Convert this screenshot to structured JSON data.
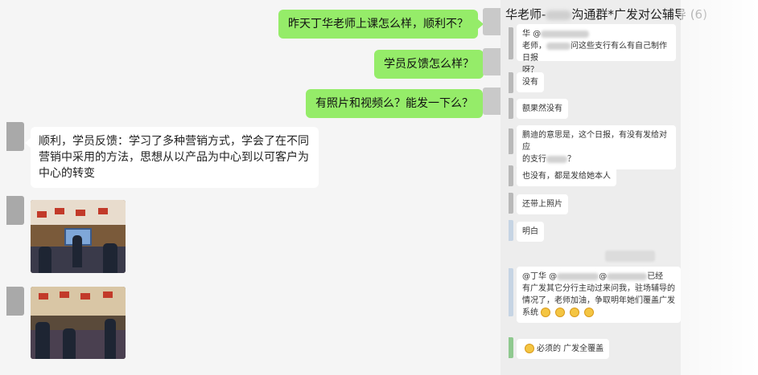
{
  "chat_left": {
    "outgoing": [
      "昨天丁华老师上课怎么样，顺利不？",
      "学员反馈怎么样？",
      "有照片和视频么？能发一下么？"
    ],
    "incoming_text": "顺利，学员反馈：学习了多种营销方式，学会了在不同营销中采用的方法，思想从以产品为中心到以可客户为中心的转变"
  },
  "chat_right": {
    "title_prefix": "华老师-",
    "title_suffix": "沟通群*广发对公辅导 (6)",
    "msg1": {
      "line1": "华 @",
      "line2_a": "老师，",
      "line2_b": "问这些支行有么有自己制作日报",
      "line3": "呀？"
    },
    "msg2": "没有",
    "msg3": "额果然没有",
    "msg4": {
      "line1": "鹏迪的意思是，这个日报，有没有发给对应",
      "line2_a": "的支行",
      "line2_b": "？"
    },
    "msg5": "也没有，都是发给她本人",
    "msg6": "还带上照片",
    "msg7": "明白",
    "msg8": {
      "line1_a": "@丁华 @",
      "line1_b": "@",
      "line1_c": "已经",
      "line2": "有广发其它分行主动过来问我，驻场辅导的",
      "line3": "情况了，老师加油，争取明年她们覆盖广发",
      "line4": "系统"
    },
    "msg9": "必须的 广发全覆盖"
  }
}
